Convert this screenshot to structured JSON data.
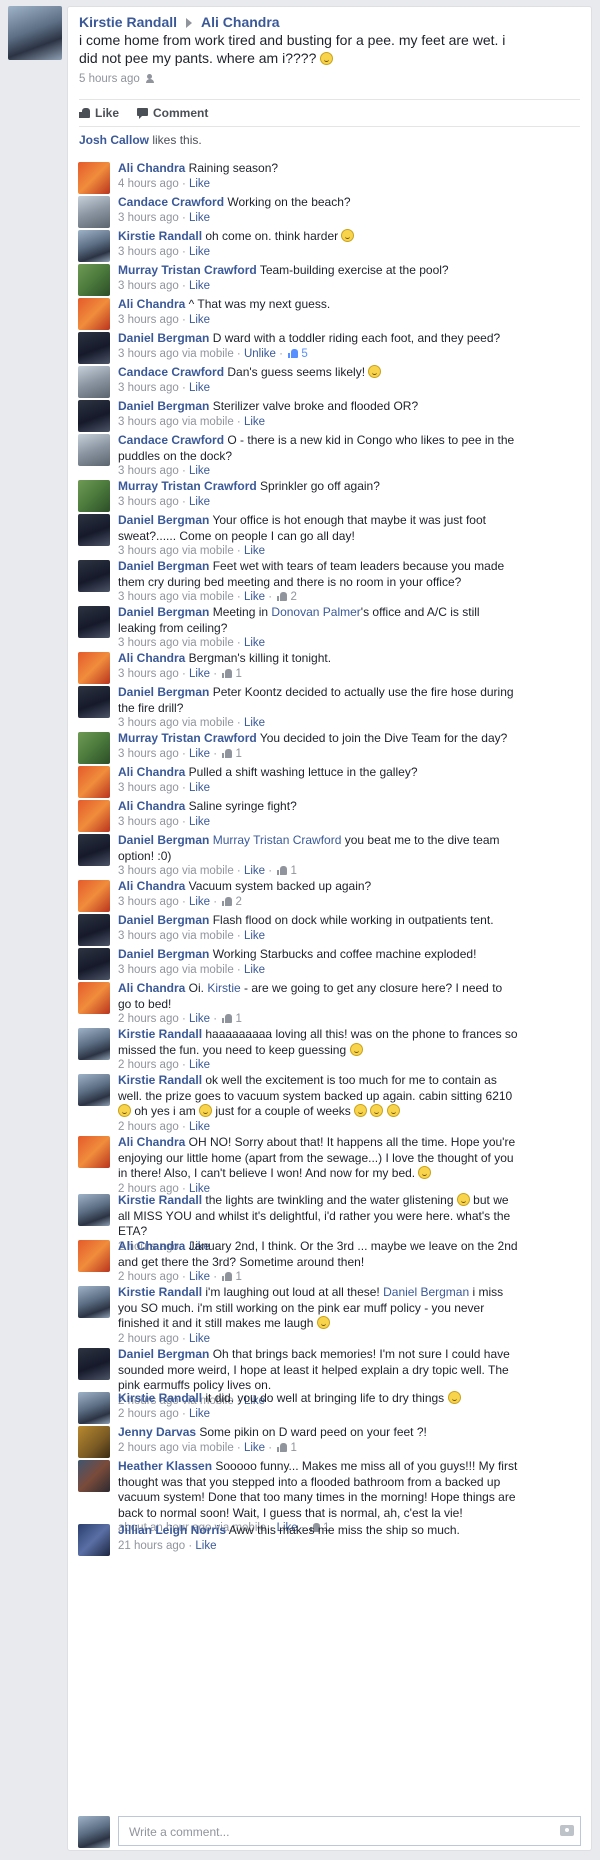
{
  "post": {
    "author": "Kirstie Randall",
    "target": "Ali Chandra",
    "text": "i come home from work tired and busting for a pee. my feet are wet. i did not pee my pants. where am i????",
    "time": "5 hours ago",
    "privacy_icon": "friends-icon"
  },
  "actions": {
    "like": "Like",
    "comment": "Comment"
  },
  "likes": {
    "name": "Josh Callow",
    "suffix": " likes this."
  },
  "comments": [
    {
      "author": "Ali Chandra",
      "avatar": "av-orange",
      "segments": [
        {
          "t": " Raining season?"
        }
      ],
      "time": "4 hours ago",
      "via": "",
      "like_label": "Like",
      "count": ""
    },
    {
      "author": "Candace Crawford",
      "avatar": "av-beach",
      "segments": [
        {
          "t": " Working on the beach?"
        }
      ],
      "time": "3 hours ago",
      "via": "",
      "like_label": "Like",
      "count": ""
    },
    {
      "author": "Kirstie Randall",
      "avatar": "av-kirstie",
      "segments": [
        {
          "t": " oh come on. think harder "
        },
        {
          "emoji": true
        }
      ],
      "time": "3 hours ago",
      "via": "",
      "like_label": "Like",
      "count": ""
    },
    {
      "author": "Murray Tristan Crawford",
      "avatar": "av-murray",
      "segments": [
        {
          "t": " Team-building exercise at the pool?"
        }
      ],
      "time": "3 hours ago",
      "via": "",
      "like_label": "Like",
      "count": ""
    },
    {
      "author": "Ali Chandra",
      "avatar": "av-orange",
      "segments": [
        {
          "t": " ^ That was my next guess."
        }
      ],
      "time": "3 hours ago",
      "via": "",
      "like_label": "Like",
      "count": ""
    },
    {
      "author": "Daniel Bergman",
      "avatar": "av-daniel",
      "segments": [
        {
          "t": " D ward with a toddler riding each foot, and they peed?"
        }
      ],
      "time": "3 hours ago",
      "via": " via mobile",
      "like_label": "Unlike",
      "count": "5",
      "count_blue": true
    },
    {
      "author": "Candace Crawford",
      "avatar": "av-beach",
      "segments": [
        {
          "t": " Dan's guess seems likely! "
        },
        {
          "emoji": true
        }
      ],
      "time": "3 hours ago",
      "via": "",
      "like_label": "Like",
      "count": ""
    },
    {
      "author": "Daniel Bergman",
      "avatar": "av-daniel",
      "segments": [
        {
          "t": " Sterilizer valve broke and flooded OR?"
        }
      ],
      "time": "3 hours ago",
      "via": " via mobile",
      "like_label": "Like",
      "count": ""
    },
    {
      "author": "Candace Crawford",
      "avatar": "av-beach",
      "segments": [
        {
          "t": " O - there is a new kid in Congo who likes to pee in the puddles on the dock?"
        }
      ],
      "time": "3 hours ago",
      "via": "",
      "like_label": "Like",
      "count": ""
    },
    {
      "author": "Murray Tristan Crawford",
      "avatar": "av-murray",
      "segments": [
        {
          "t": " Sprinkler go off again?"
        }
      ],
      "time": "3 hours ago",
      "via": "",
      "like_label": "Like",
      "count": ""
    },
    {
      "author": "Daniel Bergman",
      "avatar": "av-daniel",
      "segments": [
        {
          "t": " Your office is hot enough that maybe it was just foot sweat?...... Come on people I can go all day!"
        }
      ],
      "time": "3 hours ago",
      "via": " via mobile",
      "like_label": "Like",
      "count": ""
    },
    {
      "author": "Daniel Bergman",
      "avatar": "av-daniel",
      "segments": [
        {
          "t": " Feet wet with tears of team leaders because you made them cry during bed meeting and there is no room in your office?"
        }
      ],
      "time": "3 hours ago",
      "via": " via mobile",
      "like_label": "Like",
      "count": "2"
    },
    {
      "author": "Daniel Bergman",
      "avatar": "av-daniel",
      "segments": [
        {
          "t": " Meeting in "
        },
        {
          "link": "Donovan Palmer"
        },
        {
          "t": "'s office and A/C is still leaking from ceiling?"
        }
      ],
      "time": "3 hours ago",
      "via": " via mobile",
      "like_label": "Like",
      "count": ""
    },
    {
      "author": "Ali Chandra",
      "avatar": "av-orange",
      "segments": [
        {
          "t": " Bergman's killing it tonight."
        }
      ],
      "time": "3 hours ago",
      "via": "",
      "like_label": "Like",
      "count": "1"
    },
    {
      "author": "Daniel Bergman",
      "avatar": "av-daniel",
      "segments": [
        {
          "t": " Peter Koontz decided to actually use the fire hose during the fire drill?"
        }
      ],
      "time": "3 hours ago",
      "via": " via mobile",
      "like_label": "Like",
      "count": ""
    },
    {
      "author": "Murray Tristan Crawford",
      "avatar": "av-murray",
      "segments": [
        {
          "t": " You decided to join the Dive Team for the day?"
        }
      ],
      "time": "3 hours ago",
      "via": "",
      "like_label": "Like",
      "count": "1"
    },
    {
      "author": "Ali Chandra",
      "avatar": "av-orange",
      "segments": [
        {
          "t": " Pulled a shift washing lettuce in the galley?"
        }
      ],
      "time": "3 hours ago",
      "via": "",
      "like_label": "Like",
      "count": ""
    },
    {
      "author": "Ali Chandra",
      "avatar": "av-orange",
      "segments": [
        {
          "t": " Saline syringe fight?"
        }
      ],
      "time": "3 hours ago",
      "via": "",
      "like_label": "Like",
      "count": ""
    },
    {
      "author": "Daniel Bergman",
      "avatar": "av-daniel",
      "segments": [
        {
          "t": " "
        },
        {
          "link": "Murray Tristan Crawford"
        },
        {
          "t": " you beat me to the dive team option! :0)"
        }
      ],
      "time": "3 hours ago",
      "via": " via mobile",
      "like_label": "Like",
      "count": "1"
    },
    {
      "author": "Ali Chandra",
      "avatar": "av-orange",
      "segments": [
        {
          "t": " Vacuum system backed up again?"
        }
      ],
      "time": "3 hours ago",
      "via": "",
      "like_label": "Like",
      "count": "2"
    },
    {
      "author": "Daniel Bergman",
      "avatar": "av-daniel",
      "segments": [
        {
          "t": " Flash flood on dock while working in outpatients tent."
        }
      ],
      "time": "3 hours ago",
      "via": " via mobile",
      "like_label": "Like",
      "count": ""
    },
    {
      "author": "Daniel Bergman",
      "avatar": "av-daniel",
      "segments": [
        {
          "t": " Working Starbucks and coffee machine exploded!"
        }
      ],
      "time": "3 hours ago",
      "via": " via mobile",
      "like_label": "Like",
      "count": ""
    },
    {
      "author": "Ali Chandra",
      "avatar": "av-orange",
      "segments": [
        {
          "t": " Oi. "
        },
        {
          "link": "Kirstie"
        },
        {
          "t": " - are we going to get any closure here? I need to go to bed!"
        }
      ],
      "time": "2 hours ago",
      "via": "",
      "like_label": "Like",
      "count": "1"
    },
    {
      "author": "Kirstie Randall",
      "avatar": "av-kirstie",
      "segments": [
        {
          "t": " haaaaaaaaa loving all this! was on the phone to frances so missed the fun. you need to keep guessing "
        },
        {
          "emoji": true
        }
      ],
      "time": "2 hours ago",
      "via": "",
      "like_label": "Like",
      "count": ""
    },
    {
      "author": "Kirstie Randall",
      "avatar": "av-kirstie",
      "segments": [
        {
          "t": " ok well the excitement is too much for me to contain as well. the prize goes to vacuum system backed up again. cabin sitting 6210 "
        },
        {
          "emoji": true
        },
        {
          "t": " oh yes i am "
        },
        {
          "emoji": true
        },
        {
          "t": " just for a couple of weeks "
        },
        {
          "emoji": true
        },
        {
          "t": " "
        },
        {
          "emoji": true
        },
        {
          "t": " "
        },
        {
          "emoji": true
        }
      ],
      "time": "2 hours ago",
      "via": "",
      "like_label": "Like",
      "count": ""
    },
    {
      "author": "Ali Chandra",
      "avatar": "av-orange",
      "segments": [
        {
          "t": " OH NO! Sorry about that! It happens all the time. Hope you're enjoying our little home (apart from the sewage...) I love the thought of you in there! Also, I can't believe I won! And now for my bed. "
        },
        {
          "emoji": true
        }
      ],
      "time": "2 hours ago",
      "via": "",
      "like_label": "Like",
      "count": ""
    },
    {
      "author": "Kirstie Randall",
      "avatar": "av-kirstie",
      "segments": [
        {
          "t": " the lights are twinkling and the water glistening "
        },
        {
          "emoji": true
        },
        {
          "t": " but we all MISS YOU and whilst it's delightful, i'd rather you were here. what's the ETA?"
        }
      ],
      "time": "2 hours ago",
      "via": "",
      "like_label": "Like",
      "count": ""
    },
    {
      "author": "Ali Chandra",
      "avatar": "av-orange",
      "segments": [
        {
          "t": " January 2nd, I think. Or the 3rd ... maybe we leave on the 2nd and get there the 3rd? Sometime around then!"
        }
      ],
      "time": "2 hours ago",
      "via": "",
      "like_label": "Like",
      "count": "1"
    },
    {
      "author": "Kirstie Randall",
      "avatar": "av-kirstie",
      "segments": [
        {
          "t": " i'm laughing out loud at all these! "
        },
        {
          "link": "Daniel Bergman"
        },
        {
          "t": " i miss you SO much. i'm still working on the pink ear muff policy - you never finished it and it still makes me laugh "
        },
        {
          "emoji": true
        }
      ],
      "time": "2 hours ago",
      "via": "",
      "like_label": "Like",
      "count": ""
    },
    {
      "author": "Daniel Bergman",
      "avatar": "av-daniel",
      "segments": [
        {
          "t": " Oh that brings back memories! I'm not sure I could have sounded more weird, I hope at least it helped explain a dry topic well. The pink earmuffs policy lives on."
        }
      ],
      "time": "2 hours ago",
      "via": " via mobile",
      "like_label": "Like",
      "count": ""
    },
    {
      "author": "Kirstie Randall",
      "avatar": "av-kirstie",
      "segments": [
        {
          "t": " it did. you do well at bringing life to dry things "
        },
        {
          "emoji": true
        }
      ],
      "time": "2 hours ago",
      "via": "",
      "like_label": "Like",
      "count": ""
    },
    {
      "author": "Jenny Darvas",
      "avatar": "av-jenny",
      "segments": [
        {
          "t": " Some pikin on D ward peed on your feet ?!"
        }
      ],
      "time": "2 hours ago",
      "via": " via mobile",
      "like_label": "Like",
      "count": "1"
    },
    {
      "author": "Heather Klassen",
      "avatar": "av-heather",
      "segments": [
        {
          "t": " Sooooo funny... Makes me miss all of you guys!!! My first thought was that you stepped into a flooded bathroom from a backed up vacuum system! Done that too many times in the morning! Hope things are back to normal soon! Wait, I guess that is normal, ah, c'est la vie!"
        }
      ],
      "time": "about an hour ago",
      "via": " via mobile",
      "like_label": "Like",
      "count": "1"
    },
    {
      "author": "Jillian Leigh Norris",
      "avatar": "av-jillian",
      "segments": [
        {
          "t": " Aww this makes me miss the ship so much."
        }
      ],
      "time": "21 hours ago",
      "via": "",
      "like_label": "Like",
      "count": ""
    }
  ],
  "write_comment": {
    "placeholder": "Write a comment...",
    "avatar": "av-kirstie",
    "camera_icon": "camera-icon"
  },
  "colors": {
    "link": "#3b5998",
    "meta": "#90949c",
    "liked": "#5890ff",
    "background": "#e9eaed"
  }
}
